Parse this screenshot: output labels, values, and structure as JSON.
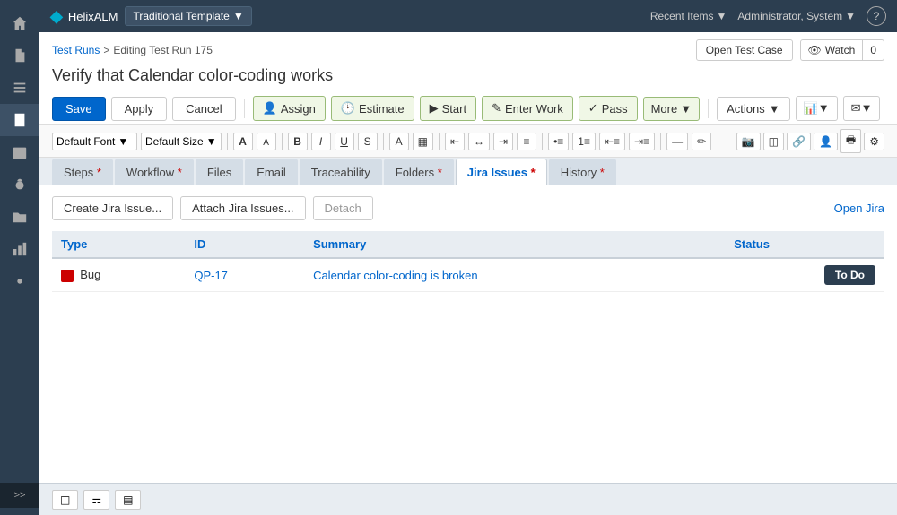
{
  "app": {
    "brand": "HelixALM",
    "template": "Traditional Template"
  },
  "topbar": {
    "recent_items": "Recent Items",
    "user": "Administrator, System",
    "help": "?"
  },
  "breadcrumb": {
    "link_text": "Test Runs",
    "separator": ">",
    "current": "Editing Test Run 175"
  },
  "header_actions": {
    "open_test_case": "Open Test Case",
    "watch": "Watch",
    "watch_count": "0"
  },
  "page_title": "Verify that Calendar color-coding works",
  "toolbar": {
    "save": "Save",
    "apply": "Apply",
    "cancel": "Cancel",
    "assign": "Assign",
    "estimate": "Estimate",
    "start": "Start",
    "enter_work": "Enter Work",
    "pass": "Pass",
    "more": "More",
    "actions": "Actions"
  },
  "format_toolbar": {
    "font": "Default Font",
    "size": "Default Size"
  },
  "tabs": [
    {
      "id": "steps",
      "label": "Steps",
      "modified": true
    },
    {
      "id": "workflow",
      "label": "Workflow",
      "modified": true
    },
    {
      "id": "files",
      "label": "Files",
      "modified": false
    },
    {
      "id": "email",
      "label": "Email",
      "modified": false
    },
    {
      "id": "traceability",
      "label": "Traceability",
      "modified": false
    },
    {
      "id": "folders",
      "label": "Folders",
      "modified": true
    },
    {
      "id": "jira-issues",
      "label": "Jira Issues",
      "modified": true,
      "active": true
    },
    {
      "id": "history",
      "label": "History",
      "modified": true
    }
  ],
  "jira_tab": {
    "create_btn": "Create Jira Issue...",
    "attach_btn": "Attach Jira Issues...",
    "detach_btn": "Detach",
    "open_jira": "Open Jira",
    "table": {
      "headers": [
        "Type",
        "ID",
        "Summary",
        "Status"
      ],
      "rows": [
        {
          "type": "Bug",
          "id": "QP-17",
          "summary": "Calendar color-coding is broken",
          "status": "To Do"
        }
      ]
    }
  },
  "sidebar": {
    "icons": [
      {
        "name": "home",
        "label": "Home"
      },
      {
        "name": "document",
        "label": "Document"
      },
      {
        "name": "list",
        "label": "List"
      },
      {
        "name": "test",
        "label": "Test"
      },
      {
        "name": "calendar",
        "label": "Calendar"
      },
      {
        "name": "bug",
        "label": "Bug"
      },
      {
        "name": "folder",
        "label": "Folder"
      },
      {
        "name": "chart",
        "label": "Chart"
      },
      {
        "name": "settings",
        "label": "Settings"
      }
    ],
    "expand_label": ">>"
  },
  "bottom_icons": [
    {
      "name": "grid-view",
      "label": "Grid"
    },
    {
      "name": "columns-view",
      "label": "Columns"
    },
    {
      "name": "list-view",
      "label": "List"
    }
  ]
}
